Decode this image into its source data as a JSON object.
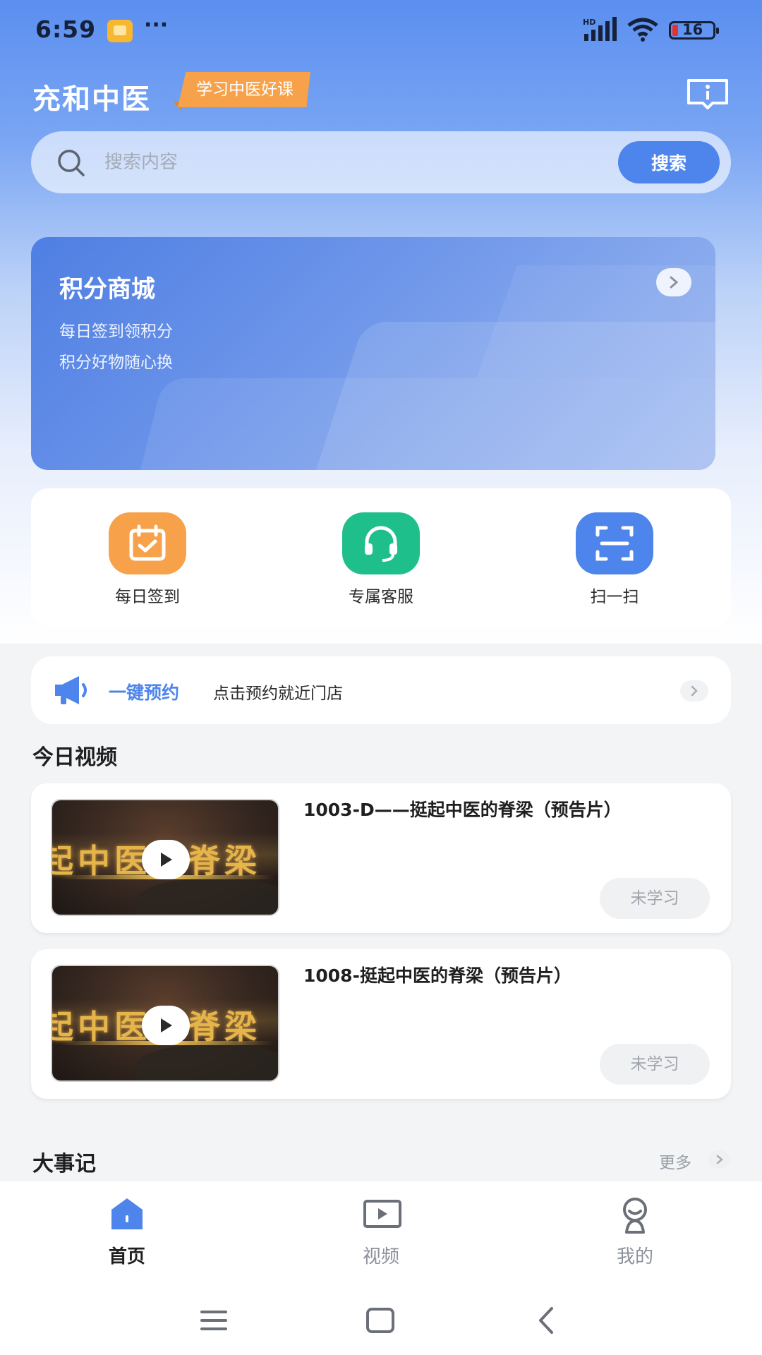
{
  "status_bar": {
    "time": "6:59",
    "dots": "···",
    "signal_label": "HD",
    "battery": "16"
  },
  "header": {
    "title": "充和中医",
    "slogan": "学习中医好课"
  },
  "search": {
    "placeholder": "搜索内容",
    "button_label": "搜索"
  },
  "banner": {
    "title": "积分商城",
    "line1": "每日签到领积分",
    "line2": "积分好物随心换"
  },
  "quick_actions": [
    {
      "label": "每日签到",
      "icon": "calendar-check-icon",
      "color": "#f7a24a"
    },
    {
      "label": "专属客服",
      "icon": "headset-icon",
      "color": "#1fbf8b"
    },
    {
      "label": "扫一扫",
      "icon": "scan-icon",
      "color": "#4e85ec"
    }
  ],
  "appointment": {
    "title": "一键预约",
    "desc": "点击预约就近门店"
  },
  "today_videos": {
    "section_title": "今日视频",
    "thumb_text": "起中医的脊梁",
    "items": [
      {
        "title": "1003-D——挺起中医的脊梁（预告片）",
        "status": "未学习"
      },
      {
        "title": "1008-挺起中医的脊梁（预告片）",
        "status": "未学习"
      }
    ]
  },
  "events": {
    "section_title": "大事记",
    "more_label": "更多"
  },
  "bottom_nav": [
    {
      "label": "首页",
      "icon": "home-icon",
      "active": true
    },
    {
      "label": "视频",
      "icon": "video-icon",
      "active": false
    },
    {
      "label": "我的",
      "icon": "profile-icon",
      "active": false
    }
  ],
  "colors": {
    "accent": "#4e85ec",
    "orange": "#f7a24a",
    "green": "#1fbf8b"
  }
}
